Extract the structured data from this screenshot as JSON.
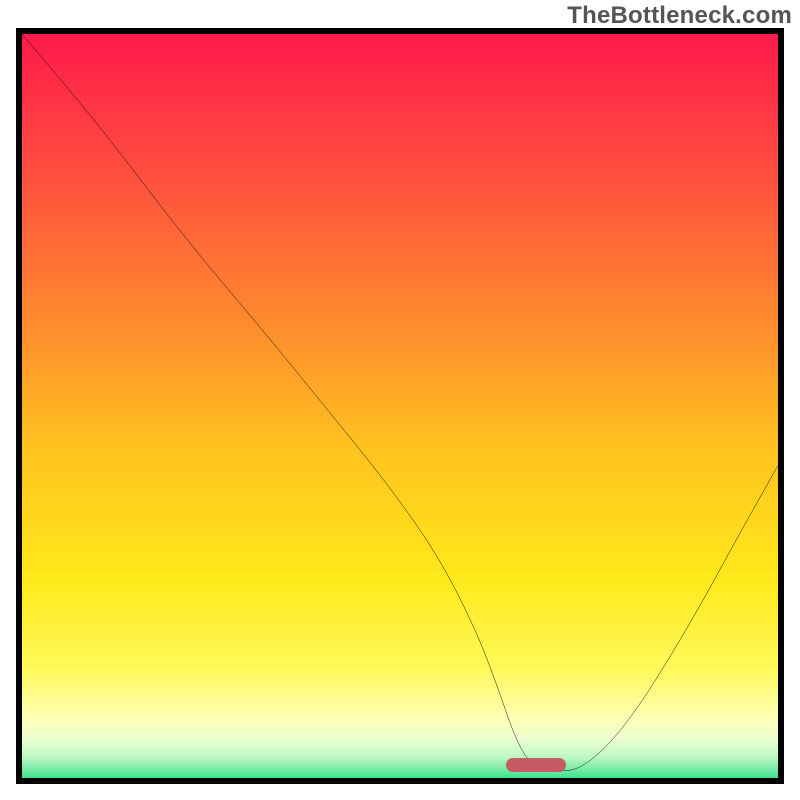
{
  "watermark": {
    "text": "TheBottleneck.com"
  },
  "colors": {
    "frame_border": "#000000",
    "curve_stroke": "#000000",
    "marker_fill": "#c65b66",
    "gradient_stops": [
      {
        "offset": 0.0,
        "color": "#ff1a4b"
      },
      {
        "offset": 0.18,
        "color": "#ff4d3f"
      },
      {
        "offset": 0.38,
        "color": "#ff8a2e"
      },
      {
        "offset": 0.55,
        "color": "#ffc31f"
      },
      {
        "offset": 0.72,
        "color": "#ffe91a"
      },
      {
        "offset": 0.84,
        "color": "#fff95a"
      },
      {
        "offset": 0.905,
        "color": "#ffffb5"
      },
      {
        "offset": 0.935,
        "color": "#eaffd1"
      },
      {
        "offset": 0.958,
        "color": "#b8f7c2"
      },
      {
        "offset": 0.975,
        "color": "#6be9a0"
      },
      {
        "offset": 0.99,
        "color": "#18df84"
      },
      {
        "offset": 1.0,
        "color": "#08d878"
      }
    ]
  },
  "chart_data": {
    "type": "line",
    "title": "",
    "xlabel": "",
    "ylabel": "",
    "xlim": [
      0,
      100
    ],
    "ylim": [
      0,
      100
    ],
    "grid": false,
    "legend": false,
    "series": [
      {
        "name": "bottleneck-curve",
        "x": [
          0,
          10,
          22,
          32,
          40,
          48,
          55,
          60,
          63,
          65,
          67,
          70,
          74,
          80,
          88,
          95,
          100
        ],
        "y": [
          100,
          88,
          72,
          60,
          50,
          40,
          30,
          20,
          12,
          6,
          2,
          1,
          1,
          7,
          20,
          33,
          42
        ]
      }
    ],
    "marker": {
      "name": "optimal-range",
      "x_start": 64,
      "x_end": 72,
      "y": 0.8
    },
    "notes": "Axis is unlabeled in source image; x/y normalized to 0–100 percent of plot area. Curve values estimated from pixels."
  }
}
